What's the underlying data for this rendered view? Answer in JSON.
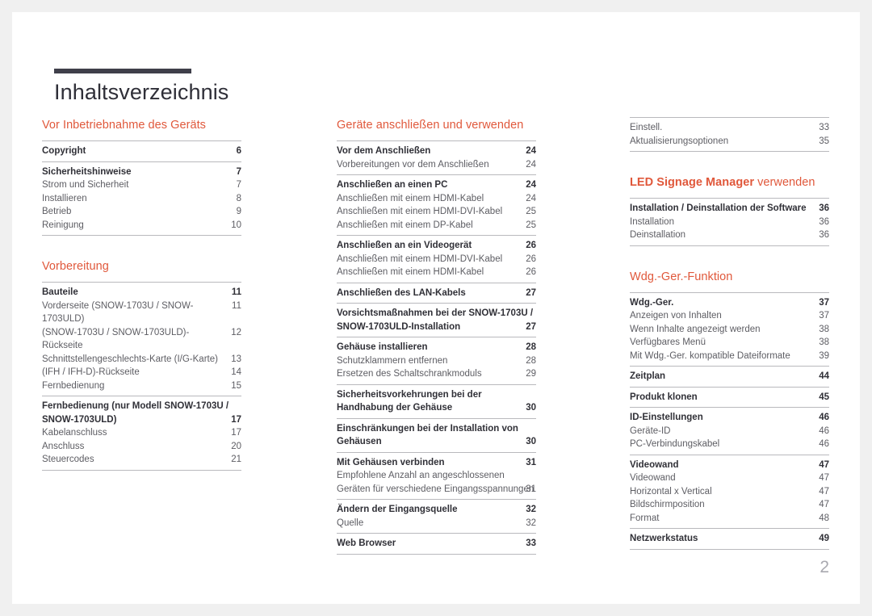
{
  "document": {
    "title": "Inhaltsverzeichnis",
    "folio": "2",
    "accent_color": "#e0583b",
    "title_rule_color": "#3f3f4a"
  },
  "columns": [
    {
      "id": "column-1",
      "sections": [
        {
          "heading": "Vor Inbetriebnahme des Geräts",
          "heading_strong": "",
          "groups": [
            {
              "entries": [
                {
                  "label": "Copyright",
                  "page": "6",
                  "level": "main"
                }
              ]
            },
            {
              "entries": [
                {
                  "label": "Sicherheitshinweise",
                  "page": "7",
                  "level": "main"
                },
                {
                  "label": "Strom und Sicherheit",
                  "page": "7",
                  "level": "sub"
                },
                {
                  "label": "Installieren",
                  "page": "8",
                  "level": "sub"
                },
                {
                  "label": "Betrieb",
                  "page": "9",
                  "level": "sub"
                },
                {
                  "label": "Reinigung",
                  "page": "10",
                  "level": "sub"
                }
              ]
            }
          ]
        },
        {
          "heading": "Vorbereitung",
          "heading_strong": "",
          "groups": [
            {
              "entries": [
                {
                  "label": "Bauteile",
                  "page": "11",
                  "level": "main"
                },
                {
                  "label": "Vorderseite (SNOW-1703U / SNOW-1703ULD)",
                  "page": "11",
                  "level": "sub"
                },
                {
                  "label": "(SNOW-1703U / SNOW-1703ULD)-Rückseite",
                  "page": "12",
                  "level": "sub"
                },
                {
                  "label": "Schnittstellengeschlechts-Karte (I/G-Karte)",
                  "page": "13",
                  "level": "sub"
                },
                {
                  "label": "(IFH / IFH-D)-Rückseite",
                  "page": "14",
                  "level": "sub"
                },
                {
                  "label": "Fernbedienung",
                  "page": "15",
                  "level": "sub"
                }
              ]
            },
            {
              "entries": [
                {
                  "label": "Fernbedienung (nur Modell SNOW-1703U / SNOW-1703ULD)",
                  "page": "17",
                  "level": "main",
                  "twoline": true
                },
                {
                  "label": "Kabelanschluss",
                  "page": "17",
                  "level": "sub"
                },
                {
                  "label": "Anschluss",
                  "page": "20",
                  "level": "sub"
                },
                {
                  "label": "Steuercodes",
                  "page": "21",
                  "level": "sub"
                }
              ]
            }
          ]
        }
      ]
    },
    {
      "id": "column-2",
      "sections": [
        {
          "heading": "Geräte anschließen und verwenden",
          "heading_strong": "",
          "groups": [
            {
              "entries": [
                {
                  "label": "Vor dem Anschließen",
                  "page": "24",
                  "level": "main"
                },
                {
                  "label": "Vorbereitungen vor dem Anschließen",
                  "page": "24",
                  "level": "sub"
                }
              ]
            },
            {
              "entries": [
                {
                  "label": "Anschließen an einen PC",
                  "page": "24",
                  "level": "main"
                },
                {
                  "label": "Anschließen mit einem HDMI-Kabel",
                  "page": "24",
                  "level": "sub"
                },
                {
                  "label": "Anschließen mit einem HDMI-DVI-Kabel",
                  "page": "25",
                  "level": "sub"
                },
                {
                  "label": "Anschließen mit einem DP-Kabel",
                  "page": "25",
                  "level": "sub"
                }
              ]
            },
            {
              "entries": [
                {
                  "label": "Anschließen an ein Videogerät",
                  "page": "26",
                  "level": "main"
                },
                {
                  "label": "Anschließen mit einem HDMI-DVI-Kabel",
                  "page": "26",
                  "level": "sub"
                },
                {
                  "label": "Anschließen mit einem HDMI-Kabel",
                  "page": "26",
                  "level": "sub"
                }
              ]
            },
            {
              "entries": [
                {
                  "label": "Anschließen des LAN-Kabels",
                  "page": "27",
                  "level": "main"
                }
              ]
            },
            {
              "entries": [
                {
                  "label": "Vorsichtsmaßnahmen bei der SNOW-1703U / SNOW-1703ULD-Installation",
                  "page": "27",
                  "level": "main",
                  "twoline": true
                }
              ]
            },
            {
              "entries": [
                {
                  "label": "Gehäuse installieren",
                  "page": "28",
                  "level": "main"
                },
                {
                  "label": "Schutzklammern entfernen",
                  "page": "28",
                  "level": "sub"
                },
                {
                  "label": "Ersetzen des Schaltschrankmoduls",
                  "page": "29",
                  "level": "sub"
                }
              ]
            },
            {
              "entries": [
                {
                  "label": "Sicherheitsvorkehrungen bei der Handhabung der Gehäuse",
                  "page": "30",
                  "level": "main",
                  "twoline": true
                }
              ]
            },
            {
              "entries": [
                {
                  "label": "Einschränkungen bei der Installation von Gehäusen",
                  "page": "30",
                  "level": "main",
                  "twoline": true
                }
              ]
            },
            {
              "entries": [
                {
                  "label": "Mit Gehäusen verbinden",
                  "page": "31",
                  "level": "main"
                },
                {
                  "label": "Empfohlene Anzahl an angeschlossenen Geräten für verschiedene Eingangsspannungen",
                  "page": "31",
                  "level": "sub",
                  "twoline": true
                }
              ]
            },
            {
              "entries": [
                {
                  "label": "Ändern der Eingangsquelle",
                  "page": "32",
                  "level": "main"
                },
                {
                  "label": "Quelle",
                  "page": "32",
                  "level": "sub"
                }
              ]
            },
            {
              "entries": [
                {
                  "label": "Web Browser",
                  "page": "33",
                  "level": "main"
                }
              ]
            }
          ]
        }
      ]
    },
    {
      "id": "column-3",
      "sections": [
        {
          "heading": "",
          "heading_strong": "",
          "continued": true,
          "groups": [
            {
              "entries": [
                {
                  "label": "Einstell.",
                  "page": "33",
                  "level": "sub"
                },
                {
                  "label": "Aktualisierungsoptionen",
                  "page": "35",
                  "level": "sub"
                }
              ]
            }
          ]
        },
        {
          "heading": " verwenden",
          "heading_strong": "LED Signage Manager",
          "groups": [
            {
              "entries": [
                {
                  "label": "Installation / Deinstallation der Software",
                  "page": "36",
                  "level": "main"
                },
                {
                  "label": "Installation",
                  "page": "36",
                  "level": "sub"
                },
                {
                  "label": "Deinstallation",
                  "page": "36",
                  "level": "sub"
                }
              ]
            }
          ]
        },
        {
          "heading": "Wdg.-Ger.-Funktion",
          "heading_strong": "",
          "groups": [
            {
              "entries": [
                {
                  "label": "Wdg.-Ger.",
                  "page": "37",
                  "level": "main"
                },
                {
                  "label": "Anzeigen von Inhalten",
                  "page": "37",
                  "level": "sub"
                },
                {
                  "label": "Wenn Inhalte angezeigt werden",
                  "page": "38",
                  "level": "sub"
                },
                {
                  "label": "Verfügbares Menü",
                  "page": "38",
                  "level": "sub"
                },
                {
                  "label": "Mit Wdg.-Ger. kompatible Dateiformate",
                  "page": "39",
                  "level": "sub"
                }
              ]
            },
            {
              "entries": [
                {
                  "label": "Zeitplan",
                  "page": "44",
                  "level": "main"
                }
              ]
            },
            {
              "entries": [
                {
                  "label": "Produkt klonen",
                  "page": "45",
                  "level": "main"
                }
              ]
            },
            {
              "entries": [
                {
                  "label": "ID-Einstellungen",
                  "page": "46",
                  "level": "main"
                },
                {
                  "label": "Geräte-ID",
                  "page": "46",
                  "level": "sub"
                },
                {
                  "label": "PC-Verbindungskabel",
                  "page": "46",
                  "level": "sub"
                }
              ]
            },
            {
              "entries": [
                {
                  "label": "Videowand",
                  "page": "47",
                  "level": "main"
                },
                {
                  "label": "Videowand",
                  "page": "47",
                  "level": "sub"
                },
                {
                  "label": "Horizontal x Vertical",
                  "page": "47",
                  "level": "sub"
                },
                {
                  "label": "Bildschirmposition",
                  "page": "47",
                  "level": "sub"
                },
                {
                  "label": "Format",
                  "page": "48",
                  "level": "sub"
                }
              ]
            },
            {
              "entries": [
                {
                  "label": "Netzwerkstatus",
                  "page": "49",
                  "level": "main"
                }
              ]
            }
          ]
        }
      ]
    }
  ]
}
